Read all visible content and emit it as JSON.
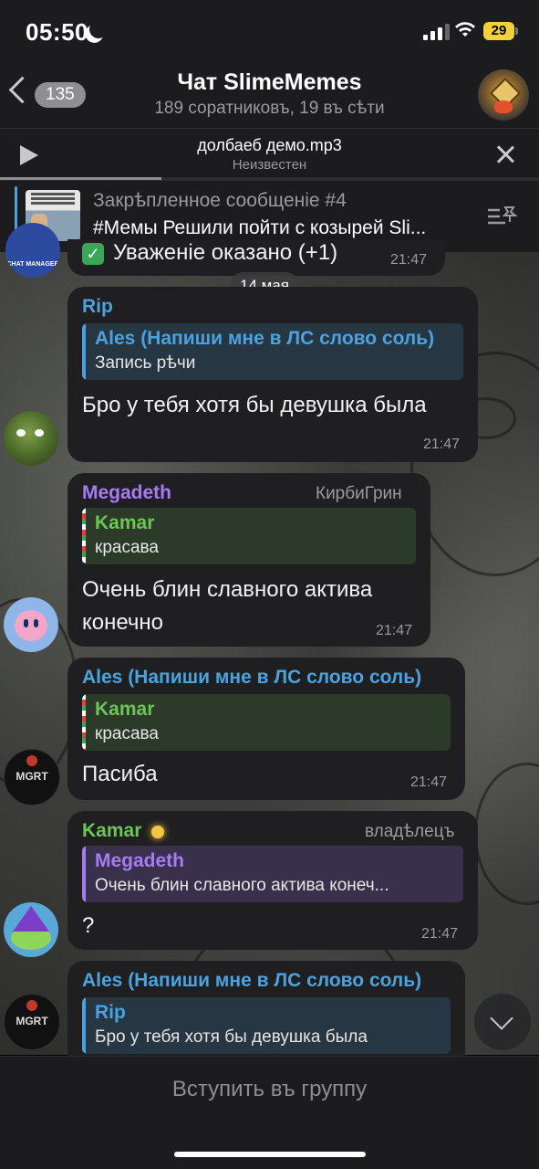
{
  "status_bar": {
    "time": "05:50",
    "battery": "29"
  },
  "header": {
    "back_count": "135",
    "title": "Чат SlimeMemes",
    "subtitle": "189 соратниковъ, 19 въ сѣти"
  },
  "player": {
    "track_title": "долбаеб демо.mp3",
    "artist": "Неизвестен",
    "progress": 0.3
  },
  "pinned": {
    "title": "Закрѣпленное сообщеніе #4",
    "text": "#Мемы Решили пойти с козырей Sli..."
  },
  "top_partial": {
    "text": "Уваженіе оказано (+1)",
    "time": "21:47"
  },
  "date_separator": "14 мая",
  "messages": [
    {
      "sender": "Rip",
      "sender_color": "#4aa3df",
      "role": "",
      "reply_name": "Ales (Напиши мне в ЛС слово соль)",
      "reply_text": "Запись рѣчи",
      "reply_color": "#4aa3df",
      "text": "Бро у тебя хотя бы девушка была",
      "time": "21:47"
    },
    {
      "sender": "Megadeth",
      "sender_color": "#a77bf3",
      "role": "КирбиГрин",
      "reply_name": "Kamar",
      "reply_text": "красава",
      "reply_color": "#6cc655",
      "text": "Очень блин славного актива конечно",
      "time": "21:47"
    },
    {
      "sender": "Ales (Напиши мне в ЛС слово соль)",
      "sender_color": "#4aa3df",
      "role": "",
      "reply_name": "Kamar",
      "reply_text": "красава",
      "reply_color": "#6cc655",
      "text": "Пасиба",
      "time": "21:47"
    },
    {
      "sender": "Kamar",
      "sender_color": "#6cc655",
      "role": "владѣлецъ",
      "reply_name": "Megadeth",
      "reply_text": "Очень блин славного актива конеч...",
      "reply_color": "#a77bf3",
      "text": "?",
      "time": "21:47"
    },
    {
      "sender": "Ales (Напиши мне в ЛС слово соль)",
      "sender_color": "#4aa3df",
      "role": "",
      "reply_name": "Rip",
      "reply_text": "Бро у тебя хотя бы девушка была",
      "reply_color": "#4aa3df",
      "text": "",
      "time": ""
    }
  ],
  "join_button": "Вступить въ группу"
}
